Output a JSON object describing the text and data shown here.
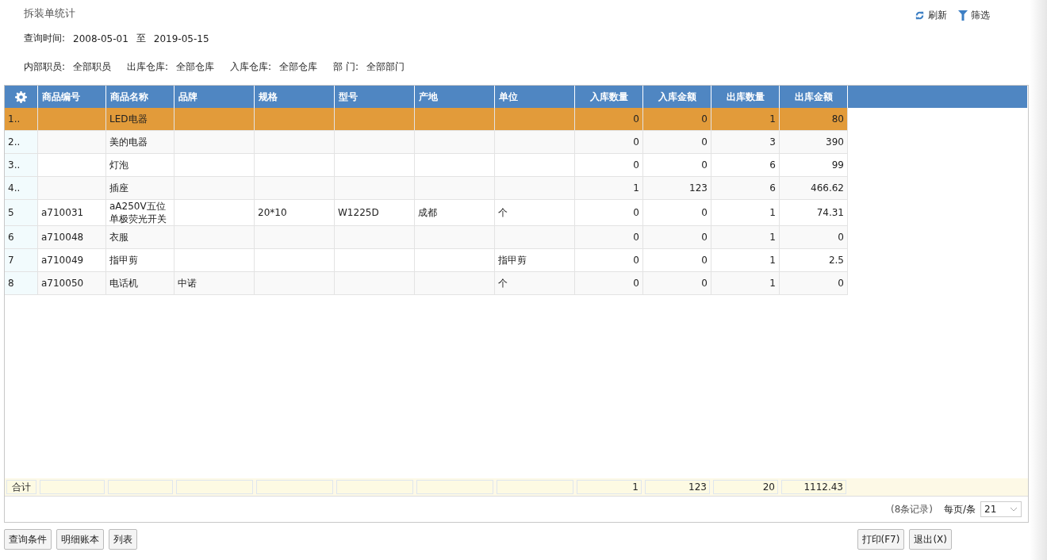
{
  "title": "拆装单统计",
  "toolbar": [
    {
      "kind": "refresh",
      "label": "刷新"
    },
    {
      "kind": "filter",
      "label": "筛选"
    }
  ],
  "query_time": {
    "label": "查询时间:",
    "from": "2008-05-01",
    "separator": "至",
    "to": "2019-05-15"
  },
  "filters": [
    {
      "label": "内部职员:",
      "value": "全部职员"
    },
    {
      "label": "出库仓库:",
      "value": "全部仓库"
    },
    {
      "label": "入库仓库:",
      "value": "全部仓库"
    },
    {
      "label": "部 门:",
      "value": "全部部门"
    }
  ],
  "table": {
    "columns": [
      {
        "label": "商品编号",
        "kind": "text"
      },
      {
        "label": "商品名称",
        "kind": "text"
      },
      {
        "label": "品牌",
        "kind": "text"
      },
      {
        "label": "规格",
        "kind": "text"
      },
      {
        "label": "型号",
        "kind": "text"
      },
      {
        "label": "产地",
        "kind": "text"
      },
      {
        "label": "单位",
        "kind": "text"
      },
      {
        "label": "入库数量",
        "kind": "number"
      },
      {
        "label": "入库金额",
        "kind": "number"
      },
      {
        "label": "出库数量",
        "kind": "number"
      },
      {
        "label": "出库金额",
        "kind": "number"
      }
    ],
    "rows": [
      {
        "index": "1..",
        "selected": true,
        "cells": [
          null,
          "LED电器",
          null,
          null,
          null,
          null,
          null,
          "0",
          "0",
          "1",
          "80"
        ]
      },
      {
        "index": "2..",
        "selected": false,
        "cells": [
          null,
          "美的电器",
          null,
          null,
          null,
          null,
          null,
          "0",
          "0",
          "3",
          "390"
        ]
      },
      {
        "index": "3..",
        "selected": false,
        "cells": [
          null,
          "灯泡",
          null,
          null,
          null,
          null,
          null,
          "0",
          "0",
          "6",
          "99"
        ]
      },
      {
        "index": "4..",
        "selected": false,
        "cells": [
          null,
          "插座",
          null,
          null,
          null,
          null,
          null,
          "1",
          "123",
          "6",
          "466.62"
        ]
      },
      {
        "index": "5",
        "selected": false,
        "cells": [
          "a710031",
          "aA250V五位单极荧光开关",
          null,
          "20*10",
          "W1225D",
          "成都",
          "个",
          "0",
          "0",
          "1",
          "74.31"
        ]
      },
      {
        "index": "6",
        "selected": false,
        "cells": [
          "a710048",
          "衣服",
          null,
          null,
          null,
          null,
          null,
          "0",
          "0",
          "1",
          "0"
        ]
      },
      {
        "index": "7",
        "selected": false,
        "cells": [
          "a710049",
          "指甲剪",
          null,
          null,
          null,
          null,
          "指甲剪",
          "0",
          "0",
          "1",
          "2.5"
        ]
      },
      {
        "index": "8",
        "selected": false,
        "cells": [
          "a710050",
          "电话机",
          "中诺",
          null,
          null,
          null,
          "个",
          "0",
          "0",
          "1",
          "0"
        ]
      }
    ],
    "totals": {
      "label": "合计",
      "cells": [
        null,
        null,
        null,
        null,
        null,
        null,
        null,
        "1",
        "123",
        "20",
        "1112.43"
      ]
    }
  },
  "pager": {
    "records": "(8条记录)",
    "per_page_label": "每页/条",
    "per_page": "21"
  },
  "buttons_left": [
    "查询条件",
    "明细账本",
    "列表"
  ],
  "buttons_right": [
    "打印(F7)",
    "退出(X)"
  ]
}
